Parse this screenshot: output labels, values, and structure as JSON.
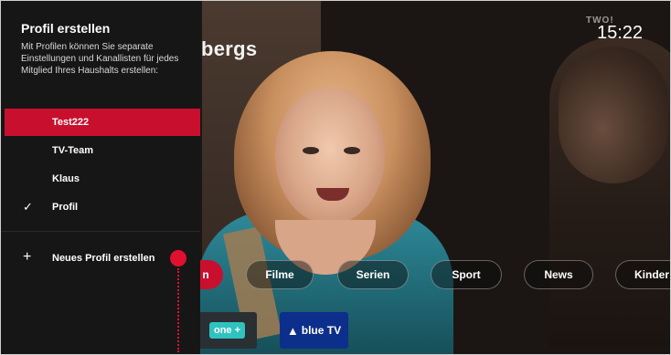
{
  "background": {
    "title_fragment": "bergs",
    "clock": "15:22",
    "channel_logo": "TWO!"
  },
  "panel": {
    "title": "Profil erstellen",
    "description": "Mit Profilen können Sie separate Einstellungen und Kanallisten für jedes Mitglied Ihres Haushalts erstellen:",
    "profiles": [
      {
        "label": "Test222",
        "state": "focused"
      },
      {
        "label": "TV-Team",
        "state": ""
      },
      {
        "label": "Klaus",
        "state": ""
      },
      {
        "label": "Profil",
        "state": "selected"
      }
    ],
    "new_profile_label": "Neues Profil erstellen",
    "accent_color": "#c8102e"
  },
  "categories": {
    "partial": "n",
    "items": [
      "Filme",
      "Serien",
      "Sport",
      "News",
      "Kinder"
    ]
  },
  "apps": {
    "one_plus": "one +",
    "blue_tv": "blue TV"
  },
  "icons": {
    "check": "check-icon",
    "plus": "plus-icon",
    "focus_indicator": "focus-dot-icon"
  }
}
